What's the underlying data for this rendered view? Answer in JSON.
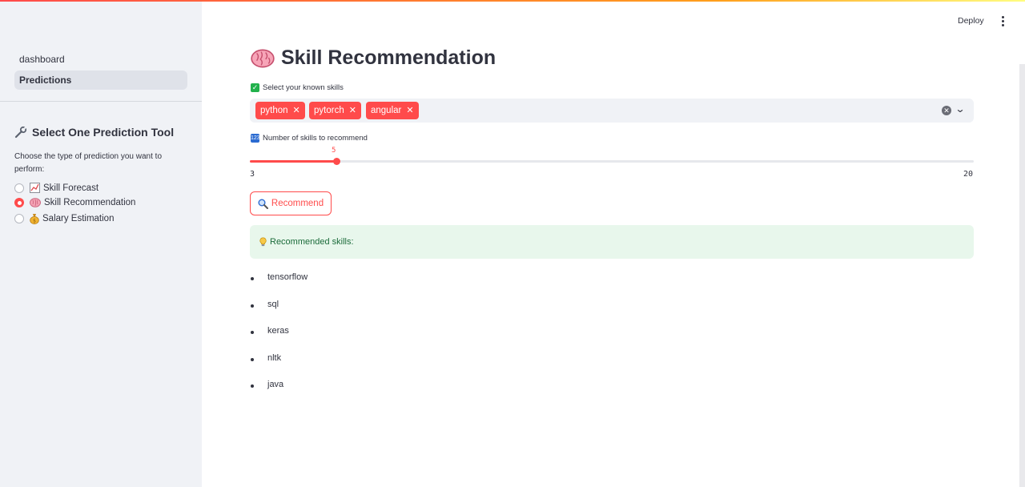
{
  "sidebar": {
    "nav": [
      {
        "label": "dashboard",
        "active": false
      },
      {
        "label": "Predictions",
        "active": true
      }
    ],
    "tool_title": "Select One Prediction Tool",
    "tool_description": "Choose the type of prediction you want to perform:",
    "options": [
      {
        "label": "Skill Forecast",
        "icon": "chart-increasing-icon",
        "checked": false
      },
      {
        "label": "Skill Recommendation",
        "icon": "brain-icon",
        "checked": true
      },
      {
        "label": "Salary Estimation",
        "icon": "money-bag-icon",
        "checked": false
      }
    ]
  },
  "header": {
    "deploy_label": "Deploy"
  },
  "main": {
    "title": "Skill Recommendation",
    "skills_label": "Select your known skills",
    "selected_skills": [
      "python",
      "pytorch",
      "angular"
    ],
    "slider": {
      "label": "Number of skills to recommend",
      "value": "5",
      "min": "3",
      "max": "20"
    },
    "button_label": "Recommend",
    "result_label": "Recommended skills:",
    "recommended": [
      "tensorflow",
      "sql",
      "keras",
      "nltk",
      "java"
    ]
  },
  "colors": {
    "accent": "#ff4b4b",
    "sidebar_bg": "#f0f2f6",
    "success_bg": "#e8f7ec",
    "text": "#31333f"
  }
}
